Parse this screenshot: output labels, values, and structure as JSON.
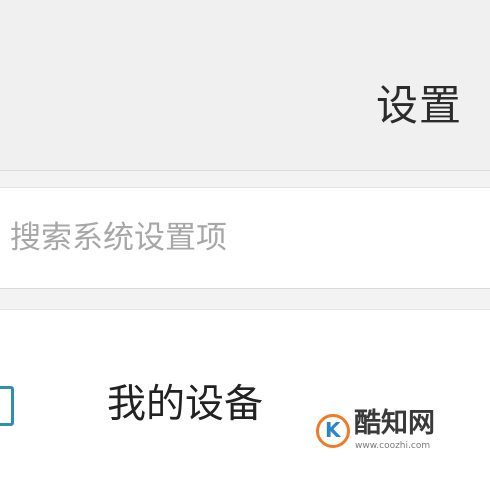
{
  "header": {
    "title": "设置"
  },
  "search": {
    "placeholder": "搜索系统设置项"
  },
  "list": {
    "items": [
      {
        "label": "我的设备",
        "icon": "device-icon"
      }
    ]
  },
  "watermark": {
    "name": "酷知网",
    "url": "www.coozhi.com"
  },
  "colors": {
    "accent": "#2f8fb0",
    "logo_orange": "#f07a26",
    "logo_blue": "#2d86c8"
  }
}
